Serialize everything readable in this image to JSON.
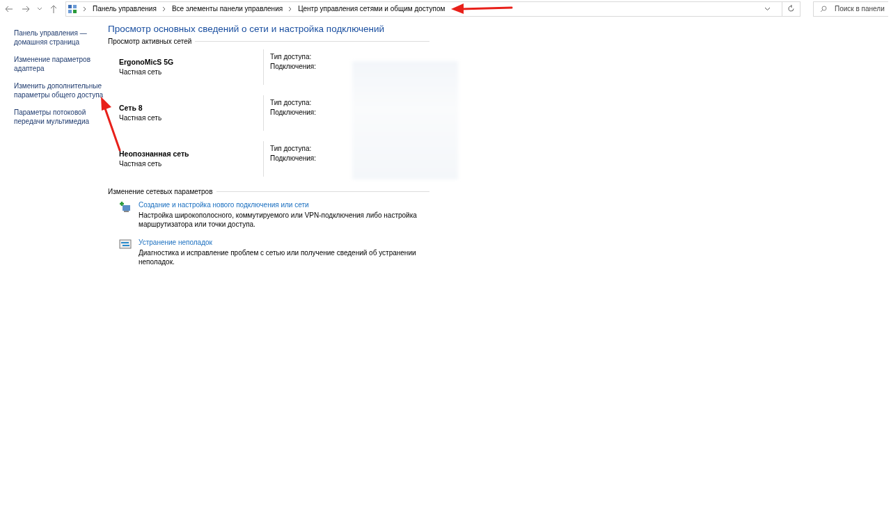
{
  "address_bar": {
    "breadcrumbs": [
      "Панель управления",
      "Все элементы панели управления",
      "Центр управления сетями и общим доступом"
    ]
  },
  "search": {
    "placeholder": "Поиск в панели"
  },
  "sidebar": {
    "items": [
      {
        "label": "Панель управления — домашняя страница"
      },
      {
        "label": "Изменение параметров адаптера"
      },
      {
        "label": "Изменить дополнительные параметры общего доступа"
      },
      {
        "label": "Параметры потоковой передачи мультимедиа"
      }
    ]
  },
  "main": {
    "title": "Просмотр основных сведений о сети и настройка подключений",
    "active_networks": {
      "heading": "Просмотр активных сетей",
      "networks": [
        {
          "name": "ErgonoMicS 5G",
          "type": "Частная сеть",
          "access_label": "Тип доступа:",
          "connections_label": "Подключения:"
        },
        {
          "name": "Сеть 8",
          "type": "Частная сеть",
          "access_label": "Тип доступа:",
          "connections_label": "Подключения:"
        },
        {
          "name": "Неопознанная сеть",
          "type": "Частная сеть",
          "access_label": "Тип доступа:",
          "connections_label": "Подключения:"
        }
      ]
    },
    "change_settings": {
      "heading": "Изменение сетевых параметров",
      "tasks": [
        {
          "kind": "new-connection",
          "link": "Создание и настройка нового подключения или сети",
          "description": "Настройка широкополосного, коммутируемого или VPN-подключения либо настройка маршрутизатора или точки доступа."
        },
        {
          "kind": "troubleshoot",
          "link": "Устранение неполадок",
          "description": "Диагностика и исправление проблем с сетью или получение сведений об устранении неполадок."
        }
      ]
    }
  }
}
